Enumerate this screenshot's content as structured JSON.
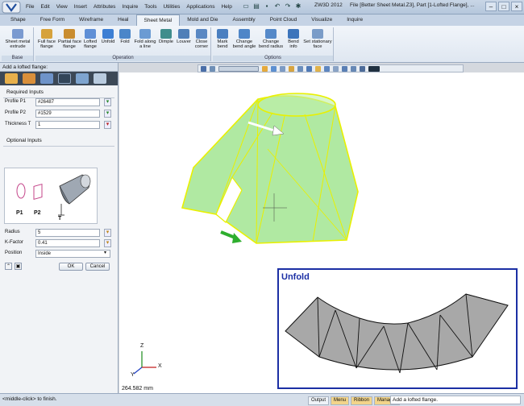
{
  "title_bar": {
    "menus": [
      "File",
      "Edit",
      "View",
      "Insert",
      "Attributes",
      "Inquire",
      "Tools",
      "Utilities",
      "Applications",
      "Help"
    ],
    "app_name": "ZW3D 2012",
    "document_title": "File [Better Sheet Metal.Z3],  Part [1-Lofted Flange],  ..."
  },
  "ribbon_tabs": [
    "Shape",
    "Free Form",
    "Wireframe",
    "Heal",
    "Sheet Metal",
    "Mold and Die",
    "Assembly",
    "Point Cloud",
    "Visualize",
    "Inquire"
  ],
  "active_tab": "Sheet Metal",
  "ribbon": {
    "groups": [
      {
        "label": "Base",
        "buttons": [
          "Sheet metal\nextrude"
        ]
      },
      {
        "label": "Operation",
        "buttons": [
          "Full face\nflange",
          "Partial face\nflange",
          "Lofted\nflange",
          "Unfold",
          "Fold",
          "Fold along\na line",
          "Dimple",
          "Louver",
          "Close\ncorner"
        ]
      },
      {
        "label": "Options",
        "buttons": [
          "Mark\nbend",
          "Change\nbend angle",
          "Change\nbend radius",
          "Bend\ninfo",
          "Set stationary\nface"
        ]
      }
    ]
  },
  "panel": {
    "header": "Add a lofted flange:",
    "required_title": "Required Inputs",
    "profile1": {
      "label": "Profile P1",
      "value": "#26487"
    },
    "profile2": {
      "label": "Profile P2",
      "value": "#1529"
    },
    "thickness": {
      "label": "Thickness T",
      "value": "1"
    },
    "optional_title": "Optional Inputs",
    "diagram_labels": {
      "p1": "P1",
      "p2": "P2",
      "t": "T"
    },
    "radius": {
      "label": "Radius",
      "value": "5"
    },
    "kfactor": {
      "label": "K-Factor",
      "value": "0.41"
    },
    "position": {
      "label": "Position",
      "value": "Inside"
    },
    "ok": "OK",
    "cancel": "Cancel"
  },
  "viewport": {
    "unfold_label": "Unfold",
    "measure": "264.582 mm",
    "triad": {
      "x": "X",
      "y": "Y",
      "z": "Z"
    }
  },
  "status_bar": {
    "message": "<middle-click> to finish.",
    "tabs": [
      "Output",
      "Menu",
      "Ribbon",
      "Manager"
    ],
    "prompt": "Add a lofted flange."
  },
  "colors": {
    "accent": "#1b2fa4",
    "model_fill": "#8fe07a",
    "model_edge": "#e9f000",
    "unfold_fill": "#a8a8a8"
  }
}
